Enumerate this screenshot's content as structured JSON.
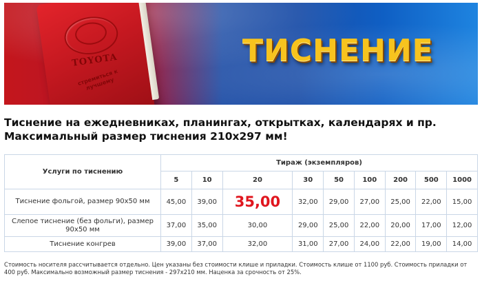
{
  "banner": {
    "title": "ТИСНЕНИЕ",
    "planner_brand": "TOYOTA",
    "planner_slogan": "стремиться к лучшему"
  },
  "heading": {
    "line1": "Тиснение на ежедневниках, планингах, открытках, календарях и пр.",
    "line2": "Максимальный размер тиснения 210х297 мм!"
  },
  "table": {
    "service_header": "Услуги по тиснению",
    "run_header": "Тираж (экземпляров)",
    "quantities": [
      "5",
      "10",
      "20",
      "30",
      "50",
      "100",
      "200",
      "500",
      "1000"
    ],
    "rows": [
      {
        "service": "Тиснение фольгой, размер 90х50 мм",
        "values": [
          "45,00",
          "39,00",
          "35,00",
          "32,00",
          "29,00",
          "27,00",
          "25,00",
          "22,00",
          "15,00"
        ]
      },
      {
        "service": "Слепое тиснение (без фольги), размер 90х50 мм",
        "values": [
          "37,00",
          "35,00",
          "30,00",
          "29,00",
          "25,00",
          "22,00",
          "20,00",
          "17,00",
          "12,00"
        ]
      },
      {
        "service": "Тиснение конгрев",
        "values": [
          "39,00",
          "37,00",
          "32,00",
          "31,00",
          "27,00",
          "24,00",
          "22,00",
          "19,00",
          "14,00"
        ]
      }
    ]
  },
  "note": "Стоимость носителя рассчитывается отдельно. Цен указаны без стоимости клише и приладки. Стоимость клише от 1100 руб. Стоимость приладки от 400 руб. Максимально возможный размер тиснения - 297х210 мм. Наценка за срочность от 25%.",
  "colors": {
    "highlight": "#e0161e",
    "border": "#c9d6e6",
    "title_gold": "#f7c31e"
  }
}
